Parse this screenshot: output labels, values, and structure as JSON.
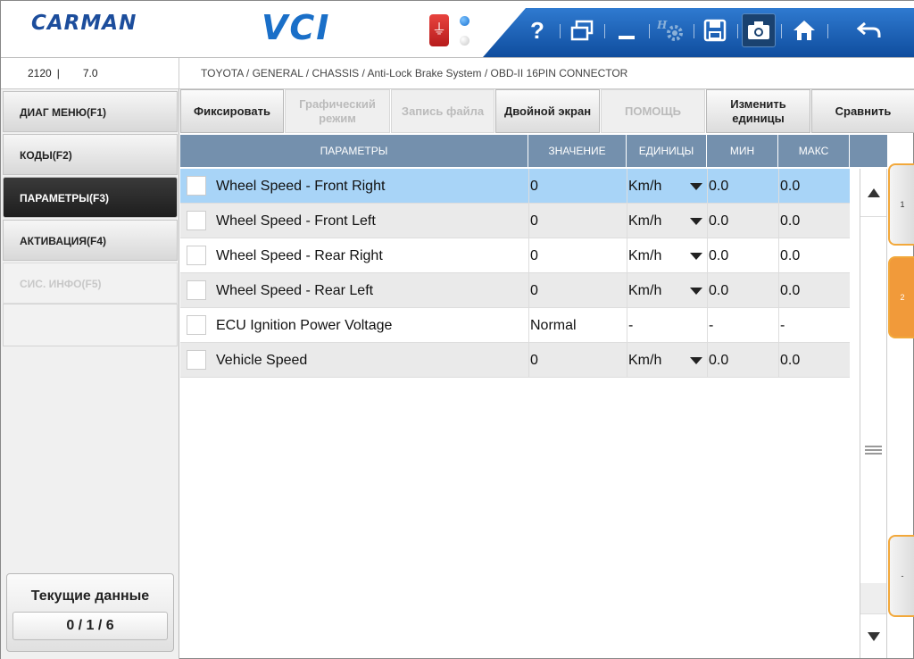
{
  "header": {
    "brand": "CARMAN",
    "product": "VCI",
    "toolbar": [
      {
        "icon": "help-icon",
        "label": "?"
      },
      {
        "icon": "window-icon",
        "label": ""
      },
      {
        "icon": "minimize-icon",
        "label": ""
      },
      {
        "icon": "settings-icon",
        "label": ""
      },
      {
        "icon": "save-icon",
        "label": ""
      },
      {
        "icon": "camera-icon",
        "label": ""
      },
      {
        "icon": "home-icon",
        "label": ""
      },
      {
        "icon": "back-icon",
        "label": ""
      }
    ]
  },
  "info": {
    "code": "2120",
    "separator": "|",
    "version": "7.0",
    "breadcrumb": "TOYOTA / GENERAL / CHASSIS / Anti-Lock Brake System / OBD-II 16PIN CONNECTOR"
  },
  "sidebar": {
    "items": [
      {
        "label": "ДИАГ МЕНЮ(F1)",
        "state": "normal"
      },
      {
        "label": "КОДЫ(F2)",
        "state": "normal"
      },
      {
        "label": "ПАРАМЕТРЫ(F3)",
        "state": "active"
      },
      {
        "label": "АКТИВАЦИЯ(F4)",
        "state": "normal"
      },
      {
        "label": "СИС. ИНФО(F5)",
        "state": "disabled"
      }
    ],
    "status_title": "Текущие данные",
    "status_count": "0 / 1 / 6"
  },
  "buttons": [
    {
      "label": "Фиксировать",
      "enabled": true
    },
    {
      "label": "Графический режим",
      "enabled": false
    },
    {
      "label": "Запись файла",
      "enabled": false
    },
    {
      "label": "Двойной экран",
      "enabled": true
    },
    {
      "label": "ПОМОЩЬ",
      "enabled": false
    },
    {
      "label": "Изменить единицы",
      "enabled": true
    },
    {
      "label": "Сравнить",
      "enabled": true
    }
  ],
  "table": {
    "columns": [
      "ПАРАМЕТРЫ",
      "ЗНАЧЕНИЕ",
      "ЕДИНИЦЫ",
      "МИН",
      "МАКС"
    ],
    "rows": [
      {
        "param": "Wheel Speed - Front Right",
        "value": "0",
        "unit": "Km/h",
        "min": "0.0",
        "max": "0.0",
        "dropdown": true
      },
      {
        "param": "Wheel Speed - Front Left",
        "value": "0",
        "unit": "Km/h",
        "min": "0.0",
        "max": "0.0",
        "dropdown": true
      },
      {
        "param": "Wheel Speed - Rear Right",
        "value": "0",
        "unit": "Km/h",
        "min": "0.0",
        "max": "0.0",
        "dropdown": true
      },
      {
        "param": "Wheel Speed - Rear Left",
        "value": "0",
        "unit": "Km/h",
        "min": "0.0",
        "max": "0.0",
        "dropdown": true
      },
      {
        "param": "ECU Ignition Power Voltage",
        "value": "Normal",
        "unit": "-",
        "min": "-",
        "max": "-",
        "dropdown": false
      },
      {
        "param": "Vehicle Speed",
        "value": "0",
        "unit": "Km/h",
        "min": "0.0",
        "max": "0.0",
        "dropdown": true
      }
    ],
    "selected_row": 0
  },
  "right_tabs": [
    "1",
    "2",
    "-"
  ],
  "colors": {
    "header_blue": "#1a5db4",
    "table_header": "#7490ad",
    "selected_row": "#a8d4f7",
    "tab_orange": "#f19a3a"
  }
}
